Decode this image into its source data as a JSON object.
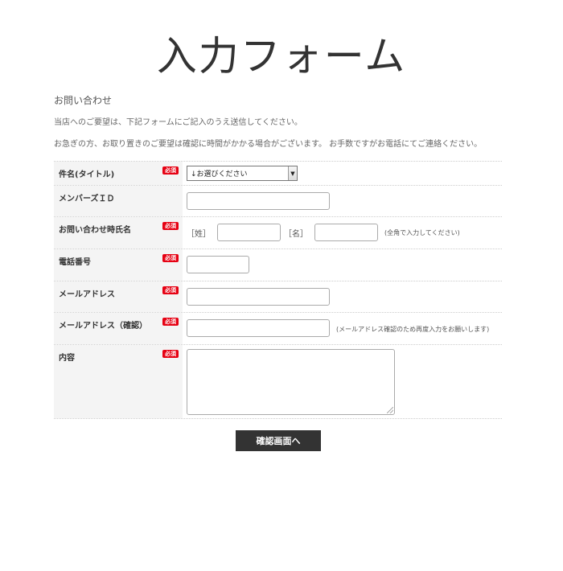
{
  "page": {
    "title": "入力フォーム"
  },
  "intro": {
    "heading": "お問い合わせ",
    "line1": "当店へのご要望は、下記フォームにご記入のうえ送信してください。",
    "line2": "お急ぎの方、お取り置きのご要望は確認に時間がかかる場合がございます。 お手数ですがお電話にてご連絡ください。"
  },
  "required_label": "必須",
  "form": {
    "subject": {
      "label": "件名(タイトル)",
      "selected": "↓お選びください"
    },
    "member_id": {
      "label": "メンバーズＩＤ",
      "value": ""
    },
    "name": {
      "label": "お問い合わせ時氏名",
      "last_label": "［姓］",
      "first_label": "［名］",
      "note": "(全角で入力してください)"
    },
    "phone": {
      "label": "電話番号",
      "value": ""
    },
    "email": {
      "label": "メールアドレス",
      "value": ""
    },
    "email_confirm": {
      "label": "メールアドレス（確認）",
      "note": "(メールアドレス確認のため再度入力をお願いします)"
    },
    "content": {
      "label": "内容",
      "value": ""
    }
  },
  "submit_label": "確認画面へ"
}
